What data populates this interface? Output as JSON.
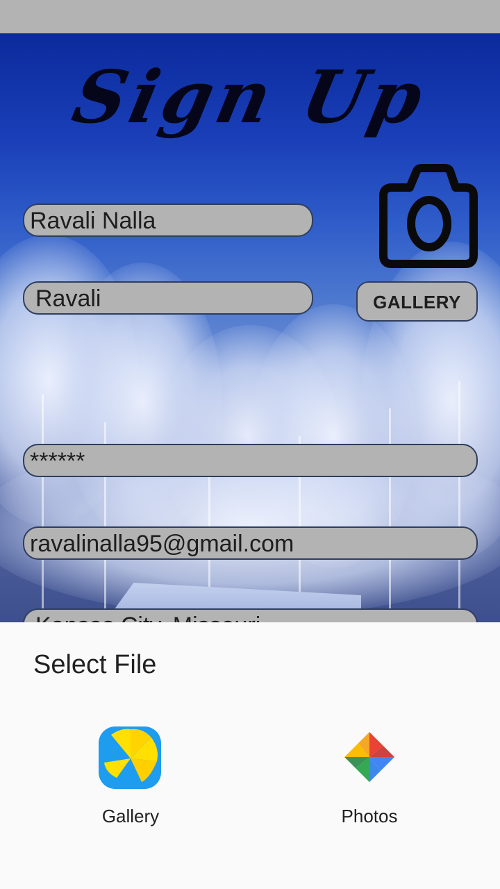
{
  "title": "Sign Up",
  "form": {
    "full_name": "Ravali Nalla",
    "username": "Ravali",
    "password_mask": "******",
    "email": "ravalinalla95@gmail.com",
    "address_partial": "Kansas City, Missouri",
    "gallery_button": "GALLERY"
  },
  "chooser": {
    "title": "Select File",
    "apps": [
      {
        "label": "Gallery",
        "icon": "gallery-app-icon"
      },
      {
        "label": "Photos",
        "icon": "photos-app-icon"
      }
    ]
  },
  "colors": {
    "field_bg": "#b3b3b3",
    "background": "#1a3fb8",
    "sheet_bg": "#fafafa"
  }
}
